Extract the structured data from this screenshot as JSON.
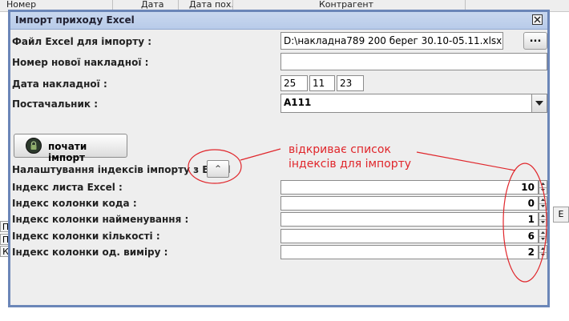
{
  "background_app": {
    "columns": [
      "Номер",
      "Дата",
      "Дата пох.",
      "Контрагент"
    ],
    "row_letters": [
      "П",
      "П",
      "К"
    ],
    "right_button": "Е"
  },
  "dialog": {
    "title": "Імпорт приходу Excel",
    "labels": {
      "file": "Файл Excel для імпорту :",
      "invoice_number": "Номер нової накладної :",
      "invoice_date": "Дата накладної :",
      "supplier": "Постачальник :",
      "index_settings": "Налаштування індексів імпорту з Excel",
      "sheet_index": "Індекс листа Excel :",
      "code_col": "Індекс колонки кода :",
      "name_col": "Індекс колонки найменування :",
      "qty_col": "Індекс колонки кількості :",
      "unit_col": "Індекс колонки од. виміру :"
    },
    "values": {
      "file_path": "D:\\накладна789 200 берег 30.10-05.11.xlsx",
      "invoice_number": "",
      "date_day": "25",
      "date_month": "11",
      "date_year": "23",
      "supplier": "А111",
      "sheet_index": "10",
      "code_col": "0",
      "name_col": "1",
      "qty_col": "6",
      "unit_col": "2"
    },
    "buttons": {
      "browse": "...",
      "start_import": "почати імпорт",
      "index_toggle": "^"
    },
    "icons": {
      "close": "close-icon",
      "dropdown": "chevron-down-icon",
      "start": "lock-icon"
    }
  },
  "annotation": {
    "text_line1": "відкриває список",
    "text_line2": "індексів для імпорту",
    "color": "#e0262b"
  }
}
